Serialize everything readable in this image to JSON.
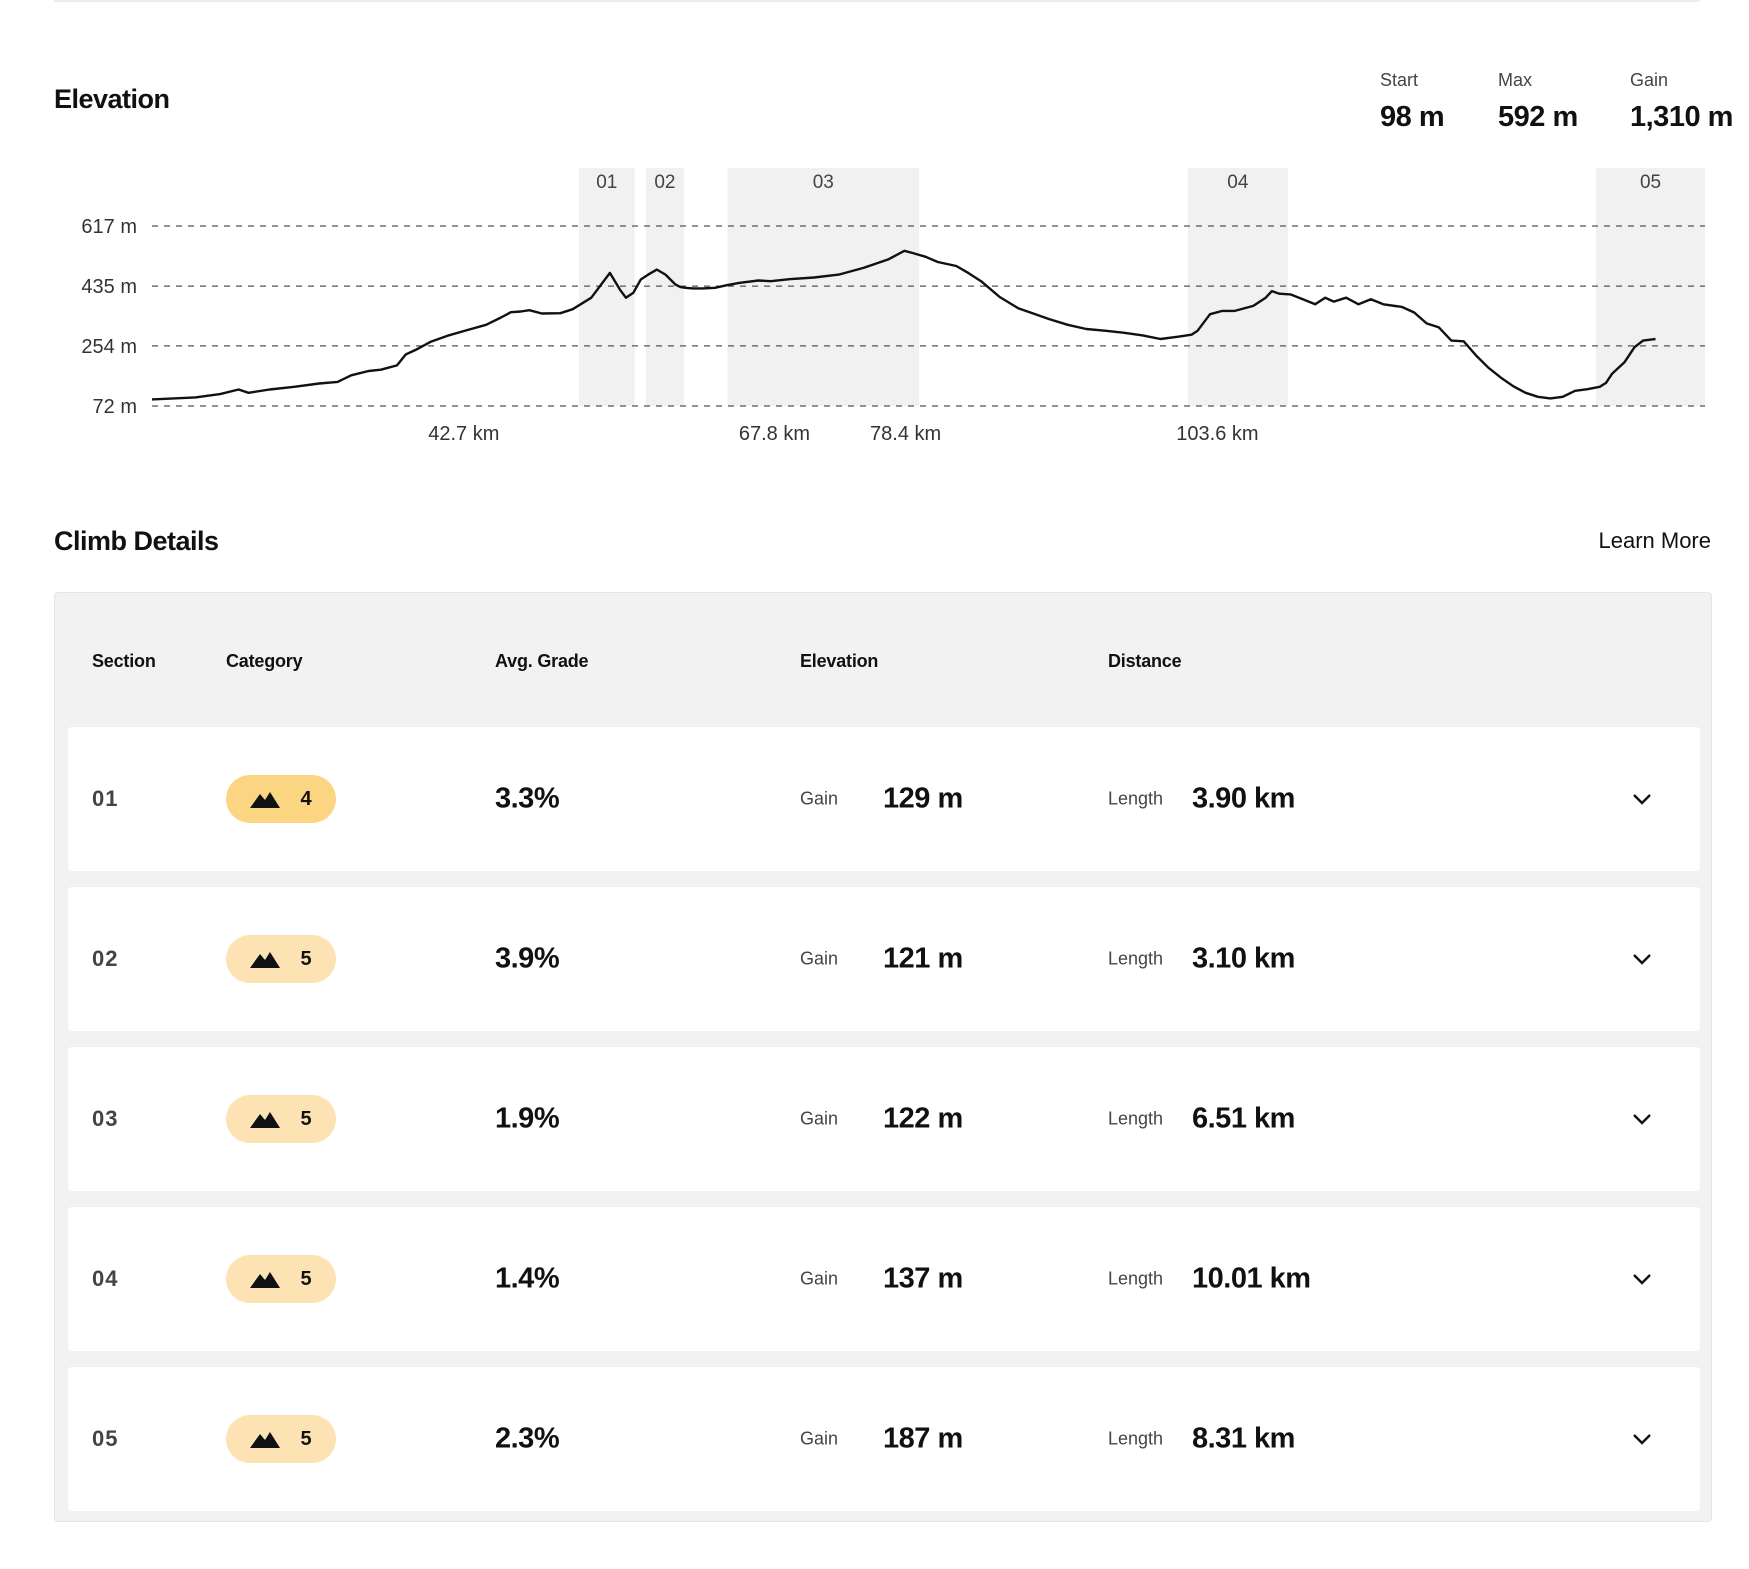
{
  "elevation": {
    "title": "Elevation",
    "stats": [
      {
        "label": "Start",
        "value": "98 m"
      },
      {
        "label": "Max",
        "value": "592 m"
      },
      {
        "label": "Gain",
        "value": "1,310 m"
      }
    ]
  },
  "chart_data": {
    "type": "area",
    "y_ticks": [
      {
        "value": 617,
        "label": "617 m"
      },
      {
        "value": 435,
        "label": "435 m"
      },
      {
        "value": 254,
        "label": "254 m"
      },
      {
        "value": 72,
        "label": "72 m"
      }
    ],
    "x_ticks": [
      {
        "value": 42.7,
        "label": "42.7 km"
      },
      {
        "value": 67.8,
        "label": "67.8 km"
      },
      {
        "value": 78.4,
        "label": "78.4 km"
      },
      {
        "value": 103.6,
        "label": "103.6 km"
      }
    ],
    "xlim": [
      17.5,
      143.0
    ],
    "ylim": [
      72,
      617
    ],
    "climb_sections": [
      {
        "label": "01",
        "start_km": 52.0,
        "end_km": 56.5
      },
      {
        "label": "02",
        "start_km": 57.4,
        "end_km": 60.5
      },
      {
        "label": "03",
        "start_km": 64.0,
        "end_km": 79.5
      },
      {
        "label": "04",
        "start_km": 101.2,
        "end_km": 109.3
      },
      {
        "label": "05",
        "start_km": 134.2,
        "end_km": 143.0
      }
    ],
    "profile": {
      "x": [
        17.5,
        21.0,
        23.0,
        24.5,
        25.3,
        27.0,
        29.0,
        31.0,
        32.5,
        33.6,
        35.0,
        36.0,
        37.3,
        38.0,
        38.8,
        40.0,
        41.5,
        43.0,
        44.5,
        45.7,
        46.5,
        47.3,
        48.0,
        49.0,
        50.5,
        51.5,
        53.0,
        54.5,
        55.3,
        55.8,
        56.4,
        57.0,
        57.6,
        58.3,
        59.0,
        59.8,
        60.2,
        60.6,
        61.2,
        62.0,
        63.0,
        64.0,
        65.0,
        66.5,
        67.5,
        69.0,
        71.0,
        73.0,
        75.0,
        77.0,
        78.3,
        79.0,
        80.0,
        81.0,
        82.5,
        83.5,
        84.5,
        86.0,
        87.5,
        89.0,
        90.0,
        91.5,
        93.0,
        94.5,
        96.0,
        97.5,
        99.0,
        100.5,
        101.5,
        102.0,
        103.0,
        104.0,
        105.0,
        106.5,
        107.5,
        108.0,
        108.6,
        109.5,
        110.5,
        111.5,
        112.3,
        113.0,
        114.0,
        115.0,
        116.0,
        117.0,
        118.5,
        119.5,
        120.5,
        121.5,
        122.5,
        123.5,
        124.5,
        125.5,
        126.5,
        127.5,
        128.5,
        129.5,
        130.5,
        131.5,
        132.5,
        133.5,
        134.5,
        135.0,
        135.5,
        136.5,
        137.3,
        138.0,
        139.0,
        140.0,
        141.0,
        142.0,
        143.0
      ],
      "y": [
        92,
        98,
        108,
        122,
        112,
        122,
        130,
        140,
        145,
        165,
        178,
        182,
        195,
        228,
        242,
        266,
        286,
        302,
        318,
        340,
        356,
        358,
        362,
        352,
        353,
        365,
        400,
        475,
        425,
        400,
        415,
        455,
        470,
        485,
        470,
        440,
        432,
        430,
        428,
        428,
        430,
        438,
        445,
        452,
        450,
        456,
        461,
        470,
        490,
        516,
        542,
        535,
        524,
        508,
        496,
        474,
        450,
        402,
        368,
        348,
        335,
        318,
        305,
        300,
        294,
        286,
        275,
        282,
        288,
        300,
        350,
        360,
        360,
        375,
        400,
        420,
        412,
        410,
        395,
        380,
        400,
        388,
        400,
        380,
        395,
        380,
        372,
        355,
        322,
        310,
        270,
        268,
        225,
        188,
        158,
        132,
        112,
        100,
        95,
        100,
        118,
        123,
        130,
        142,
        170,
        205,
        250,
        270,
        275
      ]
    }
  },
  "climb": {
    "title": "Climb Details",
    "learn_more": "Learn More",
    "headers": {
      "section": "Section",
      "category": "Category",
      "grade": "Avg. Grade",
      "elevation": "Elevation",
      "distance": "Distance"
    },
    "gain_label": "Gain",
    "length_label": "Length",
    "category_colors": {
      "4": "#fcd583",
      "5": "#fde3b4"
    },
    "rows": [
      {
        "section": "01",
        "category": "4",
        "grade": "3.3%",
        "gain": "129 m",
        "length": "3.90 km"
      },
      {
        "section": "02",
        "category": "5",
        "grade": "3.9%",
        "gain": "121 m",
        "length": "3.10 km"
      },
      {
        "section": "03",
        "category": "5",
        "grade": "1.9%",
        "gain": "122 m",
        "length": "6.51 km"
      },
      {
        "section": "04",
        "category": "5",
        "grade": "1.4%",
        "gain": "137 m",
        "length": "10.01 km"
      },
      {
        "section": "05",
        "category": "5",
        "grade": "2.3%",
        "gain": "187 m",
        "length": "8.31 km"
      }
    ]
  }
}
